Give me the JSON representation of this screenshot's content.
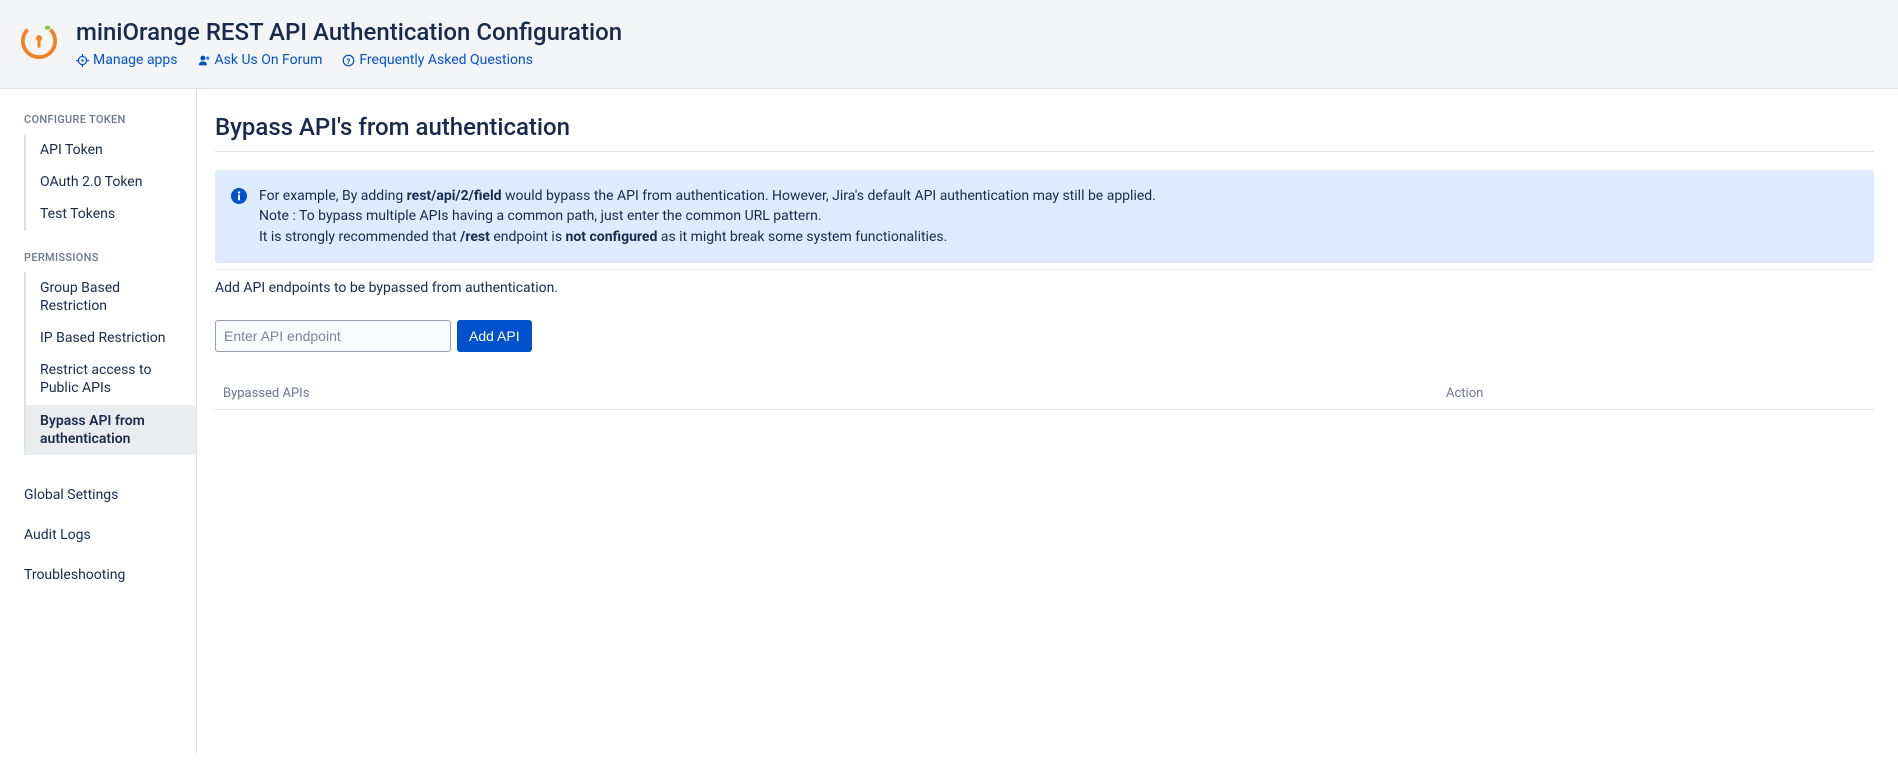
{
  "header": {
    "title": "miniOrange REST API Authentication Configuration",
    "links": {
      "manage_apps": "Manage apps",
      "ask_forum": "Ask Us On Forum",
      "faq": "Frequently Asked Questions"
    }
  },
  "sidebar": {
    "group_token_label": "CONFIGURE TOKEN",
    "token_items": [
      "API Token",
      "OAuth 2.0 Token",
      "Test Tokens"
    ],
    "group_perm_label": "PERMISSIONS",
    "perm_items": [
      "Group Based Restriction",
      "IP Based Restriction",
      "Restrict access to Public APIs",
      "Bypass API from authentication"
    ],
    "plain_items": [
      "Global Settings",
      "Audit Logs",
      "Troubleshooting"
    ]
  },
  "main": {
    "heading": "Bypass API's from authentication",
    "info": {
      "line1_pre": "For example, By adding ",
      "line1_bold": "rest/api/2/field",
      "line1_post": " would bypass the API from authentication. However, Jira's default API authentication may still be applied.",
      "line2": "Note : To bypass multiple APIs having a common path, just enter the common URL pattern.",
      "line3_pre": "It is strongly recommended that ",
      "line3_bold1": "/rest",
      "line3_mid": " endpoint is ",
      "line3_bold2": "not configured",
      "line3_post": " as it might break some system functionalities."
    },
    "description": "Add API endpoints to be bypassed from authentication.",
    "input_placeholder": "Enter API endpoint",
    "add_button": "Add API",
    "table": {
      "col_api": "Bypassed APIs",
      "col_action": "Action"
    }
  }
}
